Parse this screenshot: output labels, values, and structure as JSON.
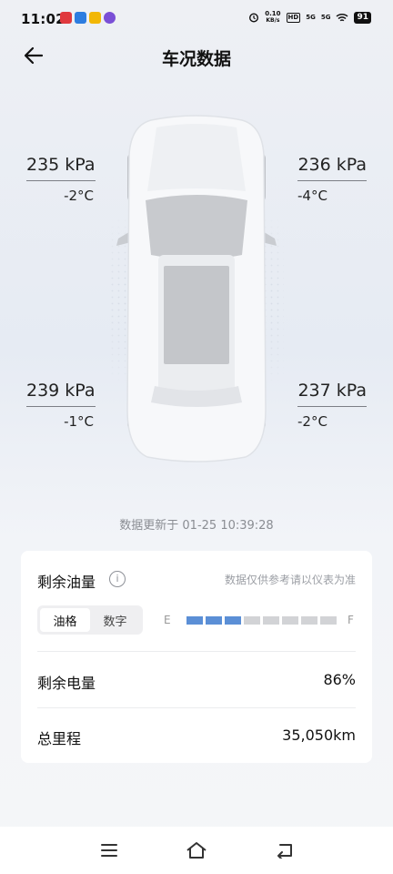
{
  "status_bar": {
    "time": "11:02",
    "net_speed_value": "0.10",
    "net_speed_unit": "KB/s",
    "hd": "HD",
    "signal_1": "5G",
    "signal_2": "5G",
    "battery": "91"
  },
  "header": {
    "title": "车况数据"
  },
  "tires": {
    "front_left": {
      "pressure": "235 kPa",
      "temp": "-2°C"
    },
    "front_right": {
      "pressure": "236 kPa",
      "temp": "-4°C"
    },
    "rear_left": {
      "pressure": "239 kPa",
      "temp": "-1°C"
    },
    "rear_right": {
      "pressure": "237 kPa",
      "temp": "-2°C"
    }
  },
  "update_text": "数据更新于 01-25 10:39:28",
  "card": {
    "fuel_title": "剩余油量",
    "info_icon_glyph": "i",
    "disclaimer": "数据仅供参考请以仪表为准",
    "tabs": [
      "油格",
      "数字"
    ],
    "active_tab": "油格",
    "fuel_empty": "E",
    "fuel_full": "F",
    "fuel_level_segments": 3,
    "fuel_total_segments": 8,
    "battery_label": "剩余电量",
    "battery_value": "86%",
    "mileage_label": "总里程",
    "mileage_value": "35,050km"
  },
  "colors": {
    "accent": "#5b8fd6",
    "bar_off": "#d2d3d6"
  }
}
